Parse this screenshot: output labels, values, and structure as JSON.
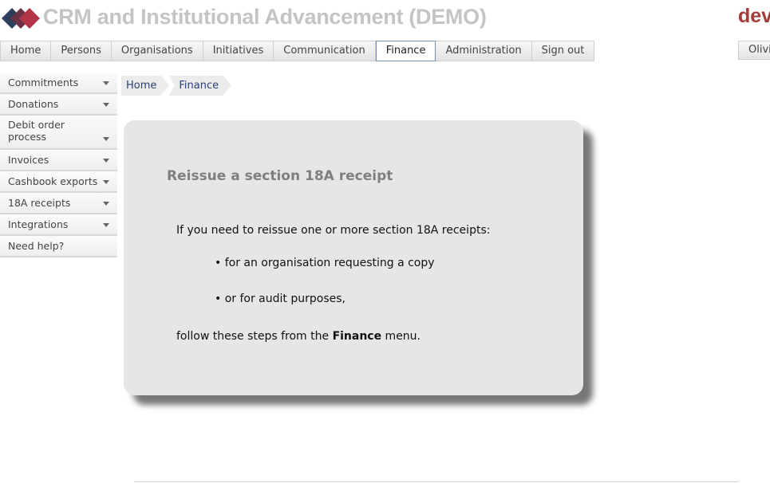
{
  "app": {
    "title": "CRM and Institutional Advancement (DEMO)",
    "brand": "dev",
    "user_label": "Olivi"
  },
  "topnav": {
    "tabs": [
      {
        "label": "Home"
      },
      {
        "label": "Persons"
      },
      {
        "label": "Organisations"
      },
      {
        "label": "Initiatives"
      },
      {
        "label": "Communication"
      },
      {
        "label": "Finance",
        "active": true
      },
      {
        "label": "Administration"
      },
      {
        "label": "Sign out"
      }
    ]
  },
  "sidebar": {
    "items": [
      {
        "label": "Commitments",
        "has_menu": true
      },
      {
        "label": "Donations",
        "has_menu": true
      },
      {
        "label": "Debit order process",
        "has_menu": true
      },
      {
        "label": "Invoices",
        "has_menu": true
      },
      {
        "label": "Cashbook exports",
        "has_menu": true
      },
      {
        "label": "18A receipts",
        "has_menu": true
      },
      {
        "label": "Integrations",
        "has_menu": true
      },
      {
        "label": "Need help?",
        "has_menu": false
      }
    ]
  },
  "breadcrumb": {
    "items": [
      "Home",
      "Finance"
    ]
  },
  "content": {
    "heading": "Reissue a section 18A receipt",
    "intro": "If you need to reissue one or more section 18A receipts:",
    "bullets": [
      "• for an organisation requesting a copy",
      "• or for audit purposes,"
    ],
    "outro_prefix": "follow these steps from the ",
    "outro_bold": "Finance",
    "outro_suffix": " menu."
  },
  "colors": {
    "title": "#c4c4c4",
    "brand": "#a43b3b",
    "card_bg": "#e6e6e6",
    "active_tab_border": "#6d8fc4",
    "link": "#2a3f7a"
  }
}
